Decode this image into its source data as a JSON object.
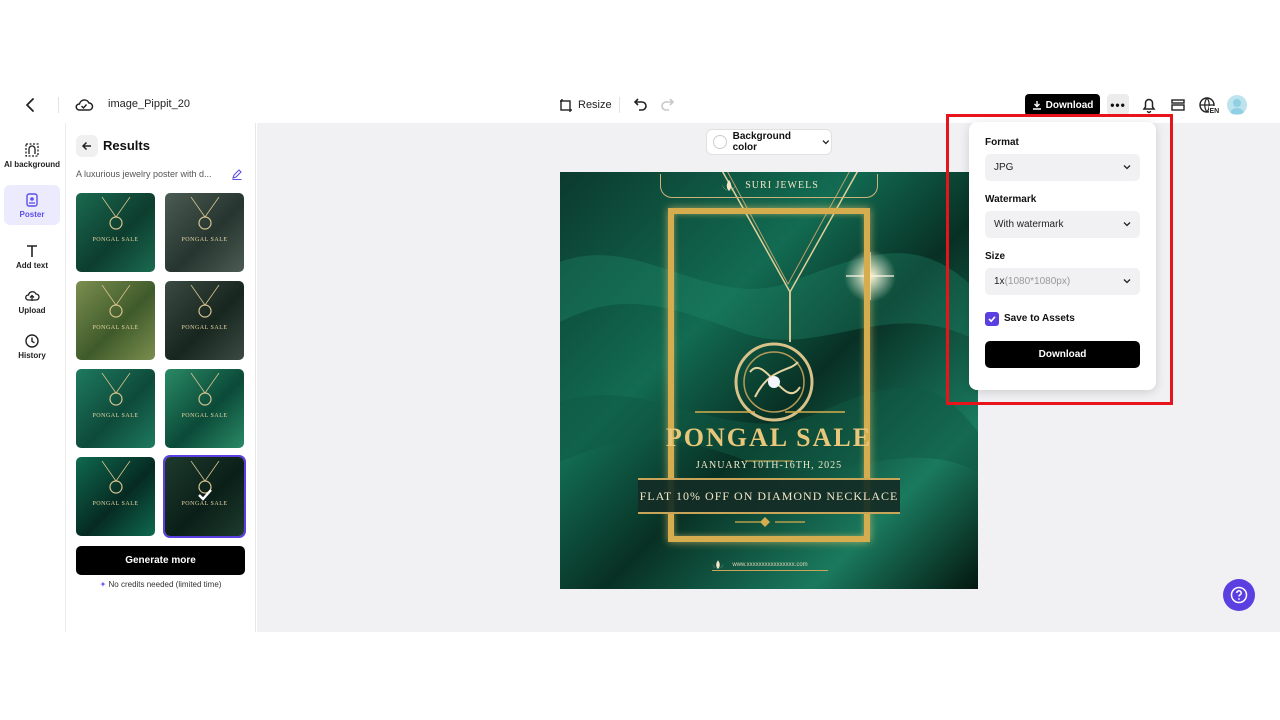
{
  "topbar": {
    "file_name": "image_Pippit_20",
    "resize_label": "Resize",
    "download_label": "Download",
    "more_label": "•••"
  },
  "rail": {
    "items": [
      {
        "label": "AI background",
        "icon": "ai-background-icon"
      },
      {
        "label": "Poster",
        "icon": "poster-icon"
      },
      {
        "label": "Add text",
        "icon": "text-icon"
      },
      {
        "label": "Upload",
        "icon": "upload-icon"
      },
      {
        "label": "History",
        "icon": "history-icon"
      }
    ]
  },
  "results": {
    "title": "Results",
    "prompt": "A luxurious jewelry poster with d...",
    "generate_label": "Generate more",
    "credits_note": "No credits needed (limited time)",
    "thumbnail_text": "PONGAL SALE"
  },
  "canvas": {
    "bg_color_label": "Background color"
  },
  "poster": {
    "brand": "SURI JEWELS",
    "title": "PONGAL SALE",
    "dates": "JANUARY 10TH-16TH, 2025",
    "offer": "FLAT 10% OFF ON DIAMOND NECKLACE",
    "url": "www.xxxxxxxxxxxxxxxx.com"
  },
  "download_panel": {
    "format_label": "Format",
    "format_value": "JPG",
    "watermark_label": "Watermark",
    "watermark_value": "With watermark",
    "size_label": "Size",
    "size_value": "1x",
    "size_detail": "(1080*1080px)",
    "save_label": "Save to Assets",
    "save_checked": true,
    "download_label": "Download"
  },
  "colors": {
    "accent": "#5b3fe0",
    "highlight_box": "#e8141b",
    "gold": "#d6ad4e"
  }
}
